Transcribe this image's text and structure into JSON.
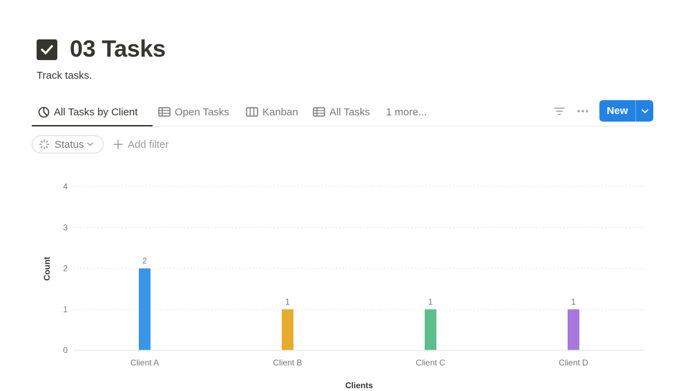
{
  "page": {
    "title": "03 Tasks",
    "description": "Track tasks."
  },
  "tabs": [
    {
      "label": "All Tasks by Client",
      "icon": "chart-pie-icon",
      "active": true
    },
    {
      "label": "Open Tasks",
      "icon": "table-icon"
    },
    {
      "label": "Kanban",
      "icon": "board-icon"
    },
    {
      "label": "All Tasks",
      "icon": "table-icon"
    },
    {
      "label": "1 more...",
      "icon": ""
    }
  ],
  "toolbar": {
    "new_label": "New"
  },
  "filters": {
    "status_label": "Status",
    "add_filter_label": "Add filter"
  },
  "colors": {
    "accent": "#2383e2",
    "text": "#37352f"
  },
  "chart_data": {
    "type": "bar",
    "categories": [
      "Client A",
      "Client B",
      "Client C",
      "Client D"
    ],
    "values": [
      2,
      1,
      1,
      1
    ],
    "colors": [
      "#3895ea",
      "#e6ac2e",
      "#5dbf8c",
      "#a678de"
    ],
    "xlabel": "Clients",
    "ylabel": "Count",
    "ylim": [
      0,
      4
    ],
    "yticks": [
      0,
      1,
      2,
      3,
      4
    ],
    "grid": true,
    "data_labels": true
  }
}
